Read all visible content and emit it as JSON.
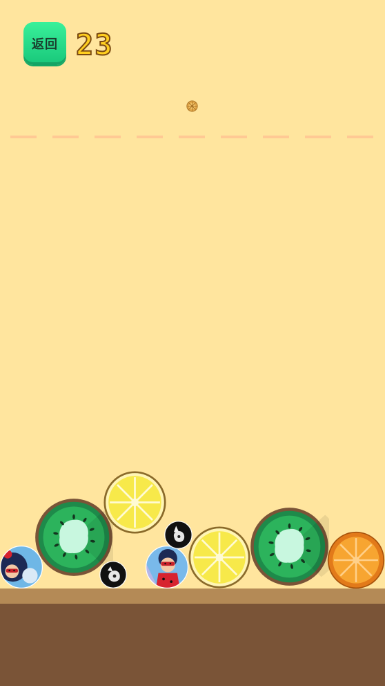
{
  "header": {
    "back_label": "返回",
    "score": "23"
  },
  "colors": {
    "background": "#ffe59e",
    "dash_line": "#ffc994",
    "ground_top": "#b48a56",
    "ground": "#7a5437",
    "back_button": "#22d987",
    "score_fill": "#ffcf1f"
  },
  "balls": [
    {
      "kind": "heroine-avatar",
      "icon": "ladybug-hero-icon"
    },
    {
      "kind": "kiwi",
      "icon": "kiwi-icon"
    },
    {
      "kind": "lemon",
      "icon": "lemon-icon"
    },
    {
      "kind": "cat-avatar",
      "icon": "cat-avatar-icon"
    },
    {
      "kind": "heroine-avatar",
      "icon": "ladybug-hero-icon"
    },
    {
      "kind": "cat-avatar",
      "icon": "cat-avatar-icon"
    },
    {
      "kind": "lemon",
      "icon": "lemon-icon"
    },
    {
      "kind": "kiwi",
      "icon": "kiwi-icon"
    },
    {
      "kind": "orange",
      "icon": "orange-icon"
    }
  ],
  "next_drop": {
    "kind": "seed",
    "icon": "seed-icon"
  }
}
